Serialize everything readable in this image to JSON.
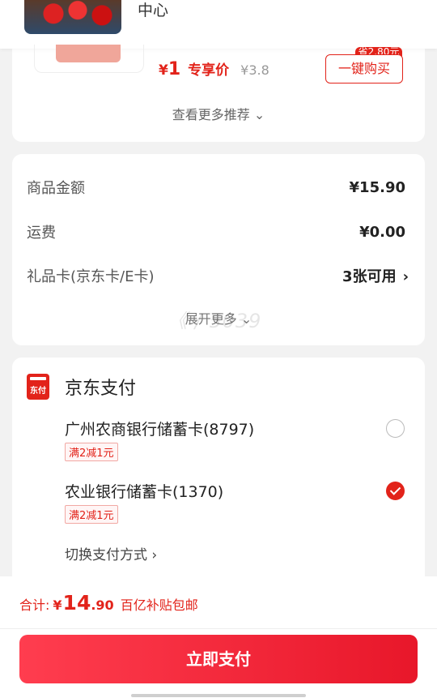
{
  "recommend": {
    "top_item_title": "中心",
    "item": {
      "price_symbol": "¥",
      "price": "1",
      "price_tag": "专享价",
      "original_price": "¥3.8",
      "save_badge": "省2.80元",
      "buy_label": "一键购买"
    },
    "more_label": "查看更多推荐 ⌄"
  },
  "amount": {
    "rows": [
      {
        "label": "商品金额",
        "value": "¥15.90"
      },
      {
        "label": "运费",
        "value": "¥0.00"
      },
      {
        "label": "礼品卡(京东卡/E卡)",
        "value": "3张可用",
        "chevron": "›"
      }
    ],
    "expand_label": "展开更多 ⌄",
    "watermark": "《 / 5039"
  },
  "payment": {
    "logo_text": "东付",
    "title": "京东支付",
    "banks": [
      {
        "name": "广州农商银行储蓄卡(8797)",
        "promo": "满2减1元",
        "selected": false
      },
      {
        "name": "农业银行储蓄卡(1370)",
        "promo": "满2减1元",
        "selected": true
      }
    ],
    "switch_label": "切换支付方式 ›"
  },
  "footer": {
    "total_label": "合计:",
    "currency": "¥",
    "total_int": "14",
    "total_dec": ".90",
    "subsidy_note": "百亿补贴包邮",
    "pay_button": "立即支付"
  },
  "colors": {
    "accent": "#e2231a",
    "background": "#f2f2f2",
    "button_gradient_start": "#ff3d4f",
    "button_gradient_end": "#e8172a"
  }
}
